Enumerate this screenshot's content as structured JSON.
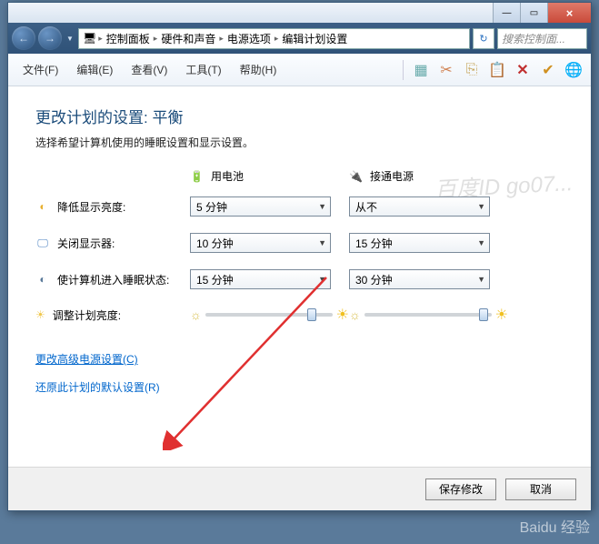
{
  "window": {
    "min": "—",
    "max": "▭",
    "close": "×"
  },
  "nav": {
    "back": "←",
    "fwd": "→"
  },
  "breadcrumb": {
    "root": "",
    "items": [
      "控制面板",
      "硬件和声音",
      "电源选项",
      "编辑计划设置"
    ]
  },
  "search": {
    "placeholder": "搜索控制面..."
  },
  "menus": {
    "file": "文件(F)",
    "edit": "编辑(E)",
    "view": "查看(V)",
    "tools": "工具(T)",
    "help": "帮助(H)"
  },
  "page": {
    "title": "更改计划的设置: 平衡",
    "subtitle": "选择希望计算机使用的睡眠设置和显示设置。",
    "col_battery": "用电池",
    "col_ac": "接通电源",
    "rows": [
      {
        "label": "降低显示亮度:",
        "battery": "5 分钟",
        "ac": "从不"
      },
      {
        "label": "关闭显示器:",
        "battery": "10 分钟",
        "ac": "15 分钟"
      },
      {
        "label": "使计算机进入睡眠状态:",
        "battery": "15 分钟",
        "ac": "30 分钟"
      }
    ],
    "brightness_label": "调整计划亮度:",
    "link_advanced": "更改高级电源设置(C)",
    "link_restore": "还原此计划的默认设置(R)"
  },
  "footer": {
    "save": "保存修改",
    "cancel": "取消"
  },
  "watermark": "百度ID go07..."
}
